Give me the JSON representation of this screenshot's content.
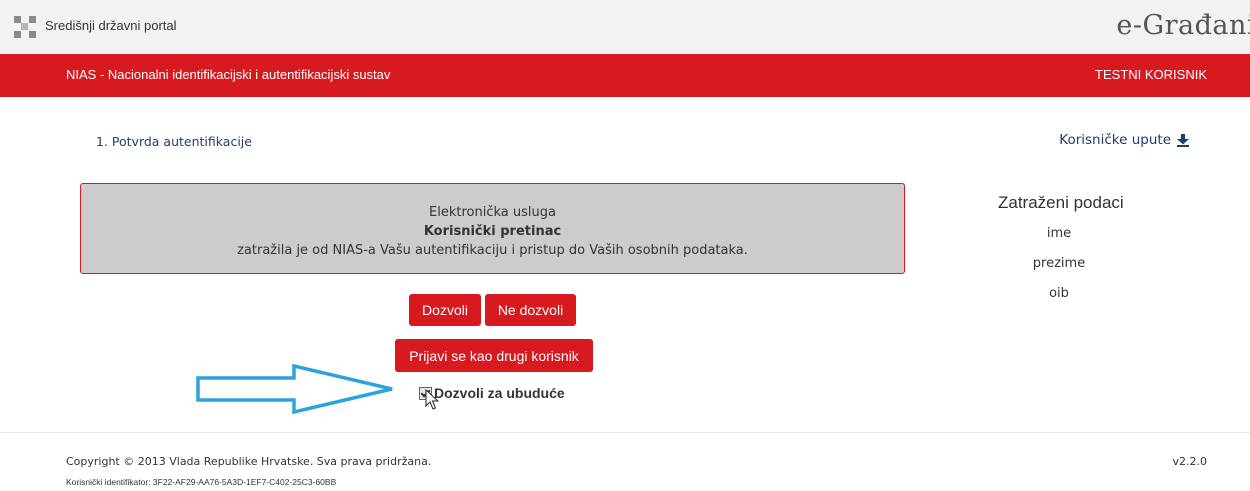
{
  "header": {
    "portal_name": "Središnji državni portal",
    "brand": "e-Građani"
  },
  "service_bar": {
    "title": "NIAS - Nacionalni identifikacijski i autentifikacijski sustav",
    "user": "TESTNI KORISNIK"
  },
  "main": {
    "step": "1. Potvrda autentifikacije",
    "guide_link": "Korisničke upute",
    "guide_icon": "download-icon",
    "notice": {
      "line1": "Elektronička usluga",
      "service_name": "Korisnički pretinac",
      "line3": "zatražila je od NIAS-a Vašu autentifikaciju i pristup do Vaših osobnih podataka."
    },
    "requested": {
      "heading": "Zatraženi podaci",
      "items": [
        "ime",
        "prezime",
        "oib"
      ]
    },
    "buttons": {
      "allow": "Dozvoli",
      "deny": "Ne dozvoli",
      "other_user": "Prijavi se kao drugi korisnik"
    },
    "remember": {
      "label": "Dozvoli za ubuduće",
      "checked": true
    }
  },
  "footer": {
    "copyright": "Copyright © 2013 Vlada Republike Hrvatske. Sva prava pridržana.",
    "version": "v2.2.0",
    "identifier": "Korisnički identifikator: 3F22-AF29-AA76-5A3D-1EF7-C402-25C3-60BB"
  },
  "colors": {
    "accent_red": "#d71920",
    "annotation_arrow": "#2ba3dc",
    "link_blue": "#1f3e6b"
  }
}
